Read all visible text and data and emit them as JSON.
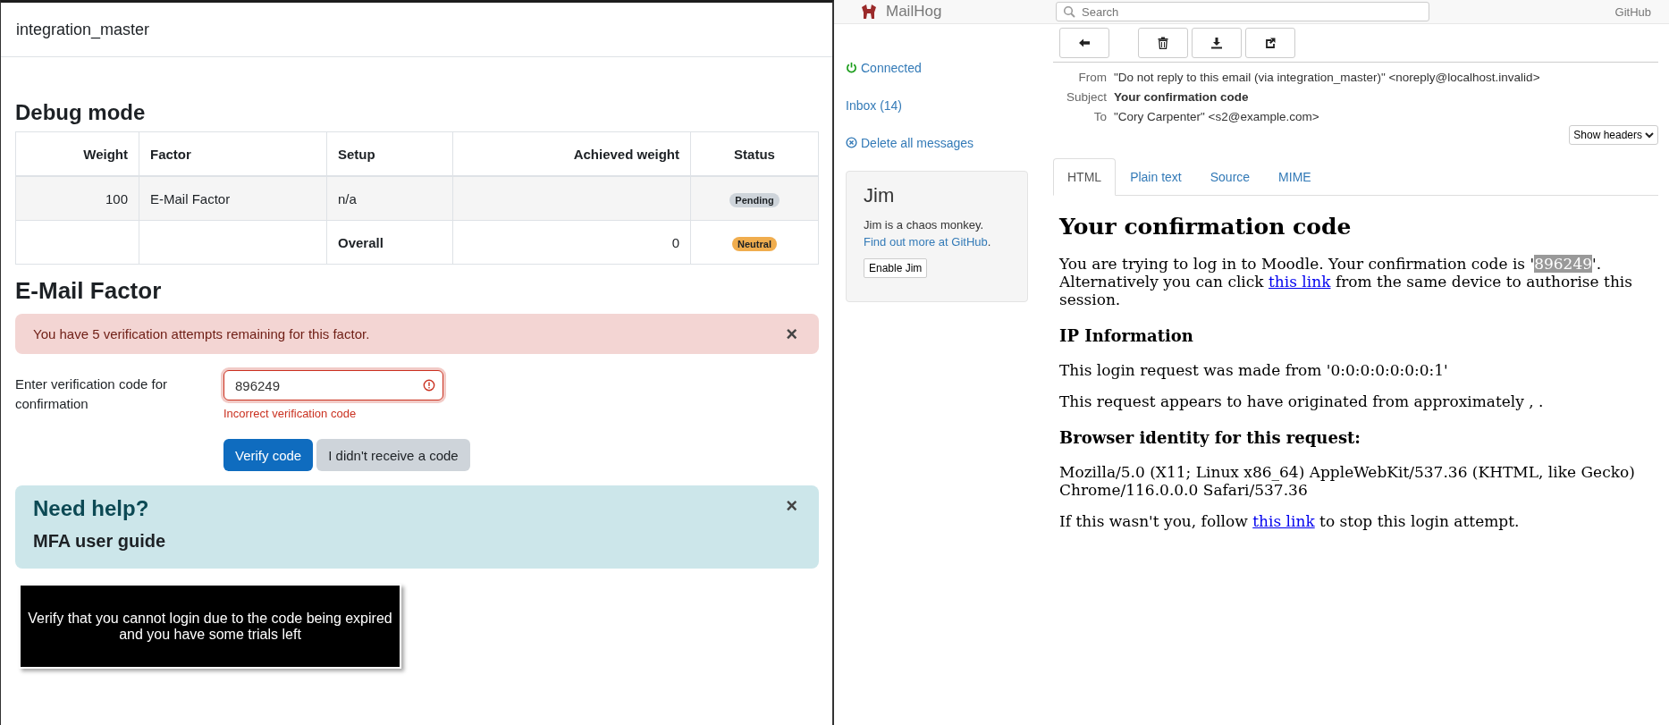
{
  "left": {
    "site_title": "integration_master",
    "debug": {
      "heading": "Debug mode",
      "columns": [
        {
          "label": "Weight"
        },
        {
          "label": "Factor"
        },
        {
          "label": "Setup"
        },
        {
          "label": "Achieved weight"
        },
        {
          "label": "Status"
        }
      ],
      "rows": [
        {
          "cells": [
            "100",
            "E-Mail Factor",
            "n/a",
            ""
          ],
          "bold": false,
          "status": {
            "label": "Pending",
            "color": "#ced4da"
          }
        },
        {
          "cells": [
            "",
            "",
            "Overall",
            "0"
          ],
          "bold": true,
          "status": {
            "label": "Neutral",
            "color": "#f0ad4e"
          }
        }
      ]
    },
    "factor_heading": "E-Mail Factor",
    "alert": {
      "text": "You have 5 verification attempts remaining for this factor.",
      "close": "×"
    },
    "form": {
      "label": "Enter verification code for confirmation",
      "value": "896249",
      "invalid": true,
      "error": "Incorrect verification code"
    },
    "buttons": [
      {
        "label": "Verify code",
        "kind": "primary"
      },
      {
        "label": "I didn't receive a code",
        "kind": "secondary"
      }
    ],
    "help": {
      "heading": "Need help?",
      "link": "MFA user guide",
      "close": "×"
    },
    "caption": "Verify that you cannot login due to the code being expired and you have some trials left"
  },
  "right": {
    "brand": "MailHog",
    "search": {
      "placeholder": "Search"
    },
    "github": "GitHub",
    "toolbar": [
      {
        "kind": "back"
      },
      {
        "kind": "delete"
      },
      {
        "kind": "download"
      },
      {
        "kind": "release"
      }
    ],
    "sidebar": [
      {
        "kind": "status",
        "label": "Connected"
      },
      {
        "kind": "link",
        "label": "Inbox (14)"
      },
      {
        "kind": "delete",
        "label": "Delete all messages"
      }
    ],
    "jim": {
      "title": "Jim",
      "text": "Jim is a chaos monkey.",
      "link": "Find out more at GitHub",
      "after": ".",
      "button": "Enable Jim"
    },
    "headers": [
      {
        "name": "From",
        "value": "\"Do not reply to this email (via integration_master)\" <noreply@localhost.invalid>",
        "bold": false
      },
      {
        "name": "Subject",
        "value": "Your confirmation code",
        "bold": true
      },
      {
        "name": "To",
        "value": "\"Cory Carpenter\" <s2@example.com>",
        "bold": false
      }
    ],
    "show_headers": "Show headers",
    "tabs": [
      {
        "label": "HTML",
        "selected": true
      },
      {
        "label": "Plain text",
        "selected": false
      },
      {
        "label": "Source",
        "selected": false
      },
      {
        "label": "MIME",
        "selected": false
      }
    ],
    "email": {
      "title": "Your confirmation code",
      "intro": {
        "before": "You are trying to log in to Moodle. Your confirmation code is '",
        "code": "896249",
        "middle": "'. Alternatively you can click ",
        "link": "this link",
        "after": " from the same device to authorise this session."
      },
      "ip_heading": "IP Information",
      "ip_lines": [
        "This login request was made from '0:0:0:0:0:0:0:1'",
        "This request appears to have originated from approximately , ."
      ],
      "browser_heading": "Browser identity for this request:",
      "user_agent": "Mozilla/5.0 (X11; Linux x86_64) AppleWebKit/537.36 (KHTML, like Gecko) Chrome/116.0.0.0 Safari/537.36",
      "outro": {
        "before": "If this wasn't you, follow ",
        "link": "this link",
        "after": " to stop this login attempt."
      }
    }
  }
}
